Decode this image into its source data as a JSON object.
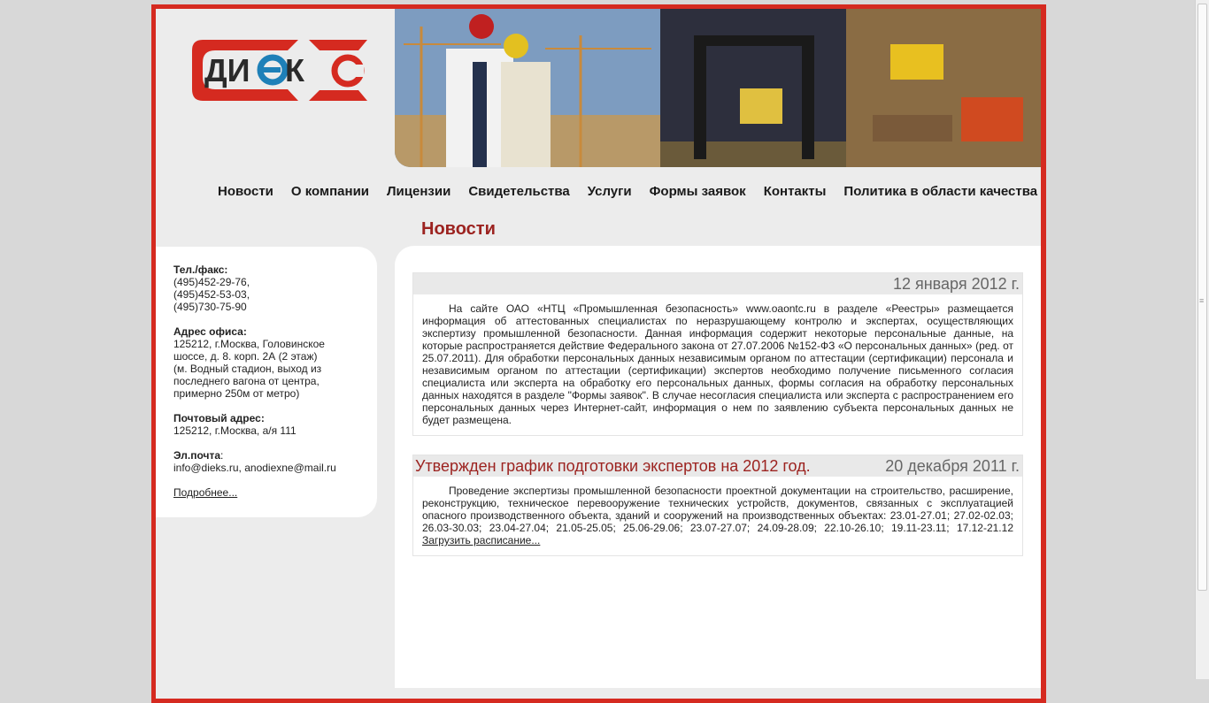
{
  "logo": {
    "text": "ДИЭКС"
  },
  "nav": [
    "Новости",
    "О компании",
    "Лицензии",
    "Свидетельства",
    "Услуги",
    "Формы заявок",
    "Контакты",
    "Политика в области качества"
  ],
  "page_title": "Новости",
  "sidebar": {
    "phone_label": "Тел./факс:",
    "phones": [
      "(495)452-29-76,",
      "(495)452-53-03,",
      "(495)730-75-90"
    ],
    "office_label": "Адрес офиса:",
    "office_lines": [
      "125212, г.Москва, Головинское",
      "шоссе, д. 8. корп. 2А (2 этаж)",
      "(м. Водный стадион, выход из",
      "последнего вагона от центра,",
      "примерно 250м от метро)"
    ],
    "post_label": "Почтовый адрес:",
    "post_address": "125212, г.Москва, а/я 111",
    "email_label": "Эл.почта",
    "email_suffix": ":",
    "emails": "info@dieks.ru, anodiexne@mail.ru",
    "more_link": "Подробнее..."
  },
  "news": [
    {
      "title": "",
      "date": "12 января 2012 г.",
      "text": "На сайте ОАО «НТЦ «Промышленная безопасность» www.oaontc.ru в разделе «Реестры» размещается информация об аттестованных специалистах по неразрушающему контролю и экспертах, осуществляющих экспертизу промышленной безопасности. Данная информация содержит некоторые персональные данные, на которые распространяется действие Федерального закона от 27.07.2006 №152-ФЗ «О персональных данных» (ред. от 25.07.2011). Для обработки персональных данных независимым органом по аттестации (сертификации) персонала и независимым органом по аттестации (сертификации) экспертов необходимо получение письменного согласия специалиста или эксперта на обработку его персональных данных, формы согласия на обработку персональных данных находятся в разделе \"Формы заявок\". В случае несогласия специалиста или эксперта с распространением его персональных данных через Интернет-сайт, информация о нем по заявлению субъекта персональных данных не будет размещена.",
      "link": ""
    },
    {
      "title": "Утвержден график подготовки экспертов на 2012 год.",
      "date": "20 декабря 2011 г.",
      "text": "Проведение экспертизы промышленной безопасности проектной документации на строительство, расширение, реконструкцию, техническое перевооружение технических устройств, документов, связанных с эксплуатацией опасного производственного объекта, зданий и сооружений на производственных объектах: 23.01-27.01; 27.02-02.03; 26.03-30.03; 23.04-27.04; 21.05-25.05; 25.06-29.06; 23.07-27.07; 24.09-28.09; 22.10-26.10; 19.11-23.11; 17.12-21.12 ",
      "link": "Загрузить расписание..."
    }
  ],
  "colors": {
    "brand_red": "#d52a20",
    "title_red": "#9c2320",
    "background": "#ececec"
  }
}
